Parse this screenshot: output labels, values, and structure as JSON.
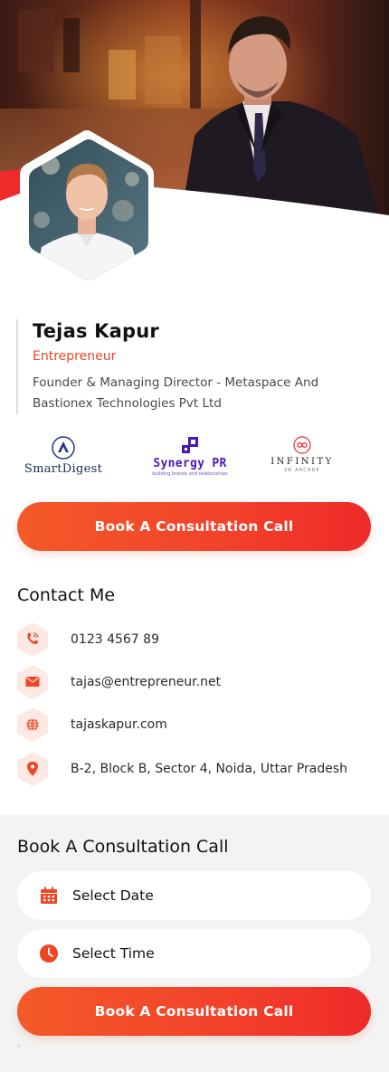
{
  "colors": {
    "accent": "#ee4622",
    "accent_dark": "#ee2a2a",
    "icon_bg": "#fde9e3",
    "section_bg": "#f3f3f3"
  },
  "profile": {
    "name": "Tejas Kapur",
    "role": "Entrepreneur",
    "description": "Founder & Managing Director - Metaspace And Bastionex Technologies Pvt Ltd"
  },
  "logos": {
    "smartdigest": "SmartDigest",
    "synergy": {
      "name": "Synergy PR",
      "tagline": "building brands and relationships"
    },
    "infinity": {
      "name": "INFINITY",
      "tagline": "VR ARCADE"
    }
  },
  "cta_label": "Book A Consultation Call",
  "contact": {
    "title": "Contact Me",
    "items": [
      {
        "icon": "phone-icon",
        "value": "0123 4567 89"
      },
      {
        "icon": "mail-icon",
        "value": "tajas@entrepreneur.net"
      },
      {
        "icon": "globe-icon",
        "value": "tajaskapur.com"
      },
      {
        "icon": "location-pin-icon",
        "value": "B-2, Block B, Sector 4, Noida, Uttar Pradesh"
      }
    ]
  },
  "booking": {
    "title": "Book A Consultation Call",
    "date_label": "Select Date",
    "time_label": "Select Time",
    "button_label": "Book A Consultation Call"
  }
}
